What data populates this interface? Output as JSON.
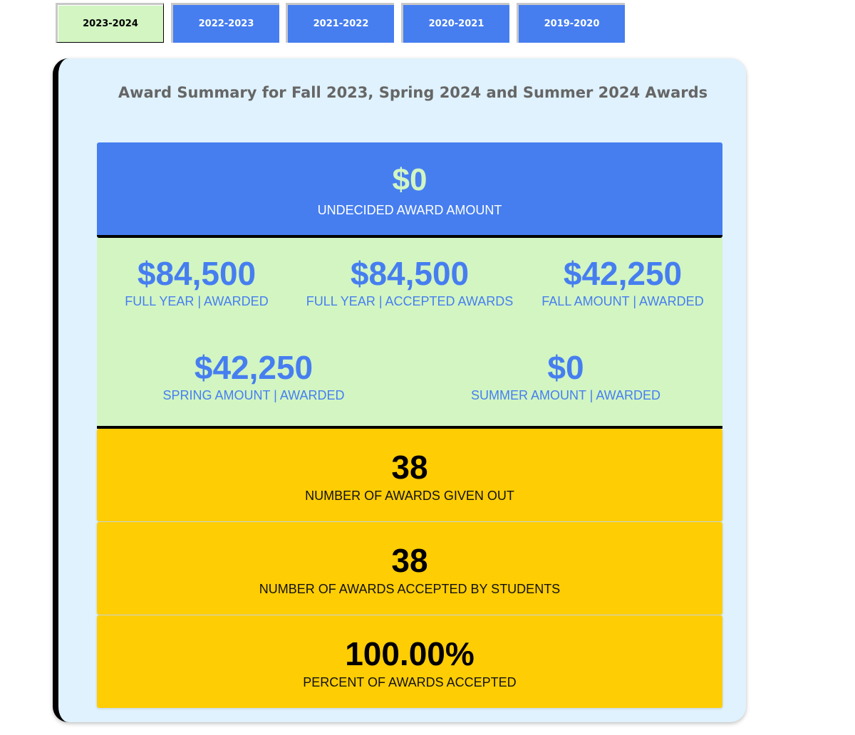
{
  "tabs": [
    {
      "label": "2023-2024",
      "active": true
    },
    {
      "label": "2022-2023",
      "active": false
    },
    {
      "label": "2021-2022",
      "active": false
    },
    {
      "label": "2020-2021",
      "active": false
    },
    {
      "label": "2019-2020",
      "active": false
    }
  ],
  "summary": {
    "title": "Award Summary for Fall 2023, Spring 2024 and Summer 2024 Awards",
    "undecided": {
      "value": "$0",
      "label": "UNDECIDED AWARD AMOUNT"
    },
    "amounts": [
      {
        "value": "$84,500",
        "label": "FULL YEAR | AWARDED"
      },
      {
        "value": "$84,500",
        "label": "FULL YEAR | ACCEPTED AWARDS"
      },
      {
        "value": "$42,250",
        "label": "FALL AMOUNT | AWARDED"
      },
      {
        "value": "$42,250",
        "label": "SPRING AMOUNT | AWARDED"
      },
      {
        "value": "$0",
        "label": "SUMMER AMOUNT | AWARDED"
      }
    ],
    "awards_given": {
      "value": "38",
      "label": "NUMBER OF AWARDS GIVEN OUT"
    },
    "awards_accepted": {
      "value": "38",
      "label": "NUMBER OF AWARDS ACCEPTED BY STUDENTS"
    },
    "percent_accepted": {
      "value": "100.00%",
      "label": "PERCENT OF AWARDS ACCEPTED"
    }
  },
  "colors": {
    "tab_blue": "#467ef0",
    "tab_active": "#d2f5c2",
    "panel_bg": "#dff2fd",
    "amount_bg": "#d2f5c2",
    "yellow": "#ffcd03"
  }
}
